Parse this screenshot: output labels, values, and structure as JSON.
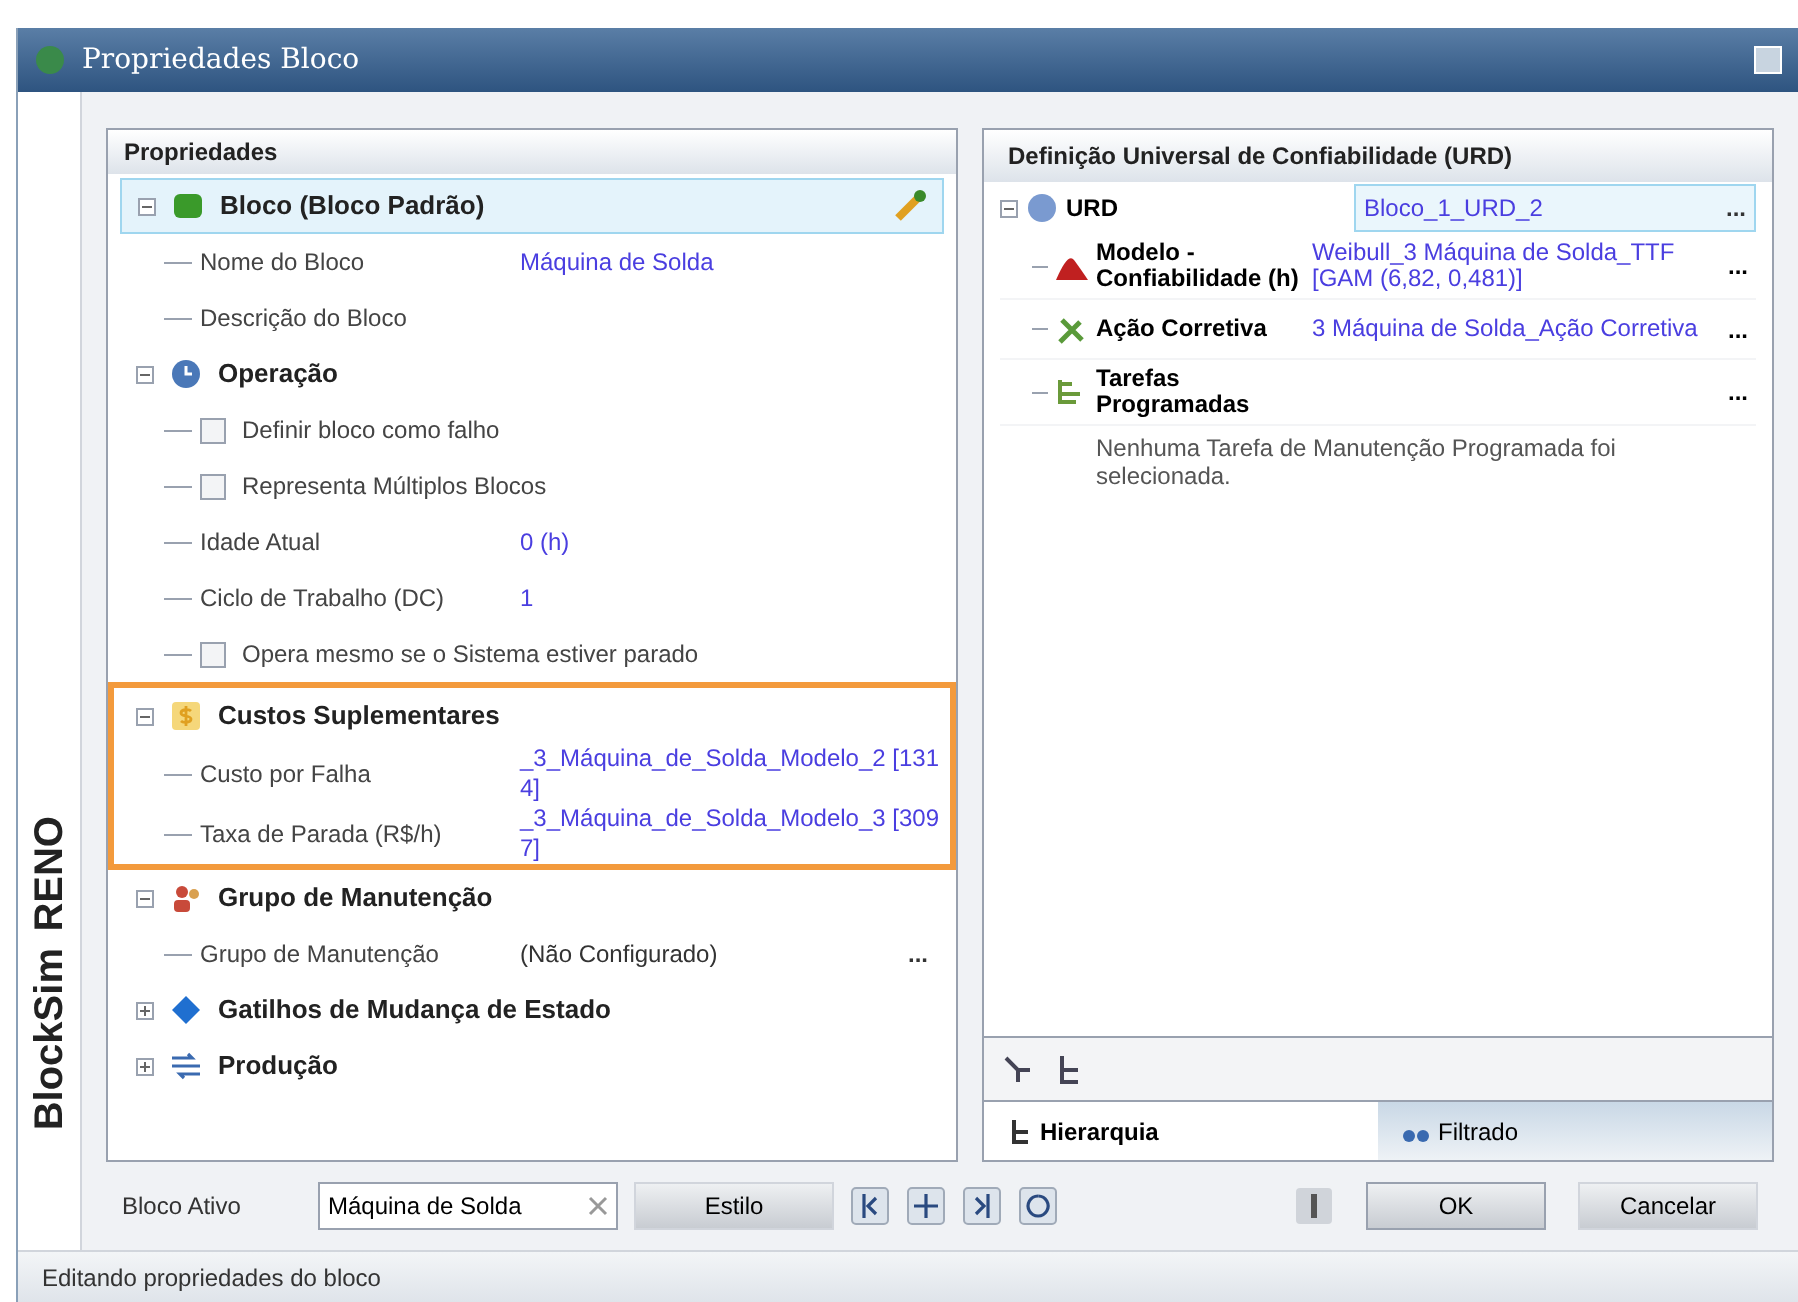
{
  "window": {
    "title": "Propriedades Bloco"
  },
  "brand": {
    "product": "BlockSim",
    "edition": "RENO"
  },
  "properties": {
    "header": "Propriedades",
    "groups": [
      {
        "title": "Bloco (Bloco Padrão)",
        "expanded": true,
        "selected": true,
        "highlighted": false,
        "rows": [
          {
            "kind": "field",
            "label": "Nome do Bloco",
            "value": "Máquina de Solda"
          },
          {
            "kind": "field",
            "label": "Descrição do Bloco"
          }
        ]
      },
      {
        "title": "Operação",
        "expanded": true,
        "selected": false,
        "highlighted": false,
        "rows": [
          {
            "kind": "checkbox",
            "label": "Definir bloco como falho",
            "checked": false
          },
          {
            "kind": "checkbox",
            "label": "Representa Múltiplos Blocos",
            "checked": false
          },
          {
            "kind": "field",
            "label": "Idade Atual",
            "value": "0 (h)"
          },
          {
            "kind": "field",
            "label": "Ciclo de Trabalho (DC)",
            "value": "1"
          },
          {
            "kind": "checkbox",
            "label": "Opera mesmo se o Sistema estiver parado",
            "checked": false
          }
        ]
      },
      {
        "title": "Custos Suplementares",
        "expanded": true,
        "selected": false,
        "highlighted": true,
        "rows": [
          {
            "kind": "field",
            "label": "Custo por Falha",
            "value": "_3_Máquina_de_Solda_Modelo_2 [1314]"
          },
          {
            "kind": "field",
            "label": "Taxa de Parada (R$/h)",
            "value": "_3_Máquina_de_Solda_Modelo_3 [3097]"
          }
        ]
      },
      {
        "title": "Grupo de Manutenção",
        "expanded": true,
        "selected": false,
        "highlighted": false,
        "rows": [
          {
            "kind": "field",
            "label": "Grupo de Manutenção",
            "value": "(Não Configurado)",
            "action": "..."
          }
        ]
      },
      {
        "title": "Gatilhos de Mudança de Estado",
        "expanded": false,
        "selected": false,
        "highlighted": false
      },
      {
        "title": "Produção",
        "expanded": false,
        "selected": false,
        "highlighted": false
      }
    ]
  },
  "urd": {
    "header": "Definição Universal de Confiabilidade (URD)",
    "root": {
      "label": "URD",
      "value": "Bloco_1_URD_2",
      "action": "...",
      "expanded": true
    },
    "rows": [
      {
        "label": "Modelo - Confiabilidade (h)",
        "value": "Weibull_3 Máquina de Solda_TTF [GAM (6,82, 0,481)]",
        "action": "..."
      },
      {
        "label": "Ação Corretiva",
        "value": "3 Máquina de Solda_Ação Corretiva",
        "action": "..."
      },
      {
        "label": "Tarefas Programadas",
        "action": "..."
      }
    ],
    "note": "Nenhuma Tarefa de Manutenção Programada foi selecionada.",
    "tabs": [
      {
        "label": "Hierarquia",
        "selected": true
      },
      {
        "label": "Filtrado",
        "selected": false
      }
    ]
  },
  "footer": {
    "active_label": "Bloco Ativo",
    "active_value": "Máquina de Solda",
    "style_button": "Estilo",
    "ok": "OK",
    "cancel": "Cancelar"
  },
  "status_bar": "Editando propriedades do bloco"
}
